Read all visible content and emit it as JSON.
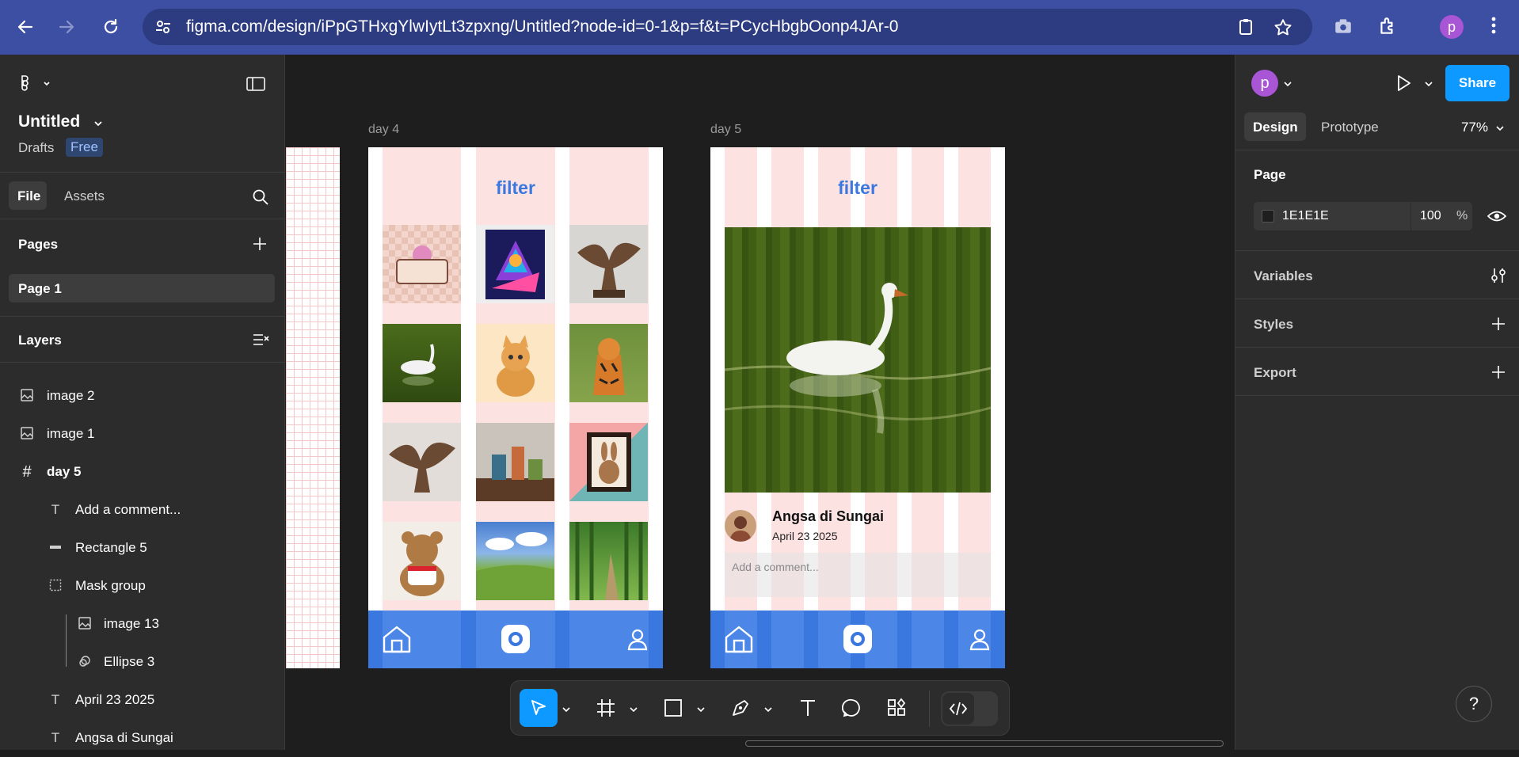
{
  "browser": {
    "url": "figma.com/design/iPpGTHxgYlwIytLt3zpxng/Untitled?node-id=0-1&p=f&t=PCycHbgbOonp4JAr-0",
    "avatar_letter": "p"
  },
  "left_panel": {
    "file_name": "Untitled",
    "drafts_label": "Drafts",
    "plan_badge": "Free",
    "tabs": [
      "File",
      "Assets"
    ],
    "pages_heading": "Pages",
    "current_page": "Page 1",
    "layers_heading": "Layers",
    "layers": [
      {
        "name": "image 2",
        "icon": "image-icon"
      },
      {
        "name": "image 1",
        "icon": "image-icon"
      },
      {
        "name": "day 5",
        "icon": "frame-icon"
      },
      {
        "name": "Add a comment...",
        "icon": "text-icon"
      },
      {
        "name": "Rectangle 5",
        "icon": "rectangle-icon"
      },
      {
        "name": "Mask group",
        "icon": "mask-icon"
      },
      {
        "name": "image 13",
        "icon": "image-icon"
      },
      {
        "name": "Ellipse 3",
        "icon": "ellipse-mask-icon"
      },
      {
        "name": "April 23 2025",
        "icon": "text-icon"
      },
      {
        "name": "Angsa di Sungai",
        "icon": "text-icon"
      }
    ]
  },
  "canvas": {
    "frame_day4": {
      "label": "day 4",
      "filter_text": "filter"
    },
    "frame_day5": {
      "label": "day 5",
      "filter_text": "filter",
      "post_title": "Angsa di Sungai",
      "post_date": "April 23 2025",
      "comment_placeholder": "Add a comment..."
    }
  },
  "right_panel": {
    "avatar_letter": "p",
    "share_label": "Share",
    "tabs": [
      "Design",
      "Prototype"
    ],
    "zoom": "77%",
    "page_section": "Page",
    "page_color_hex": "1E1E1E",
    "page_opacity": "100",
    "percent_sign": "%",
    "variables_label": "Variables",
    "styles_label": "Styles",
    "export_label": "Export"
  },
  "help_label": "?",
  "colors": {
    "accent": "#0d99ff",
    "frame_stripe": "#fde2e2",
    "nav_blue": "#3a78e0",
    "filter_blue": "#3a78e0"
  }
}
